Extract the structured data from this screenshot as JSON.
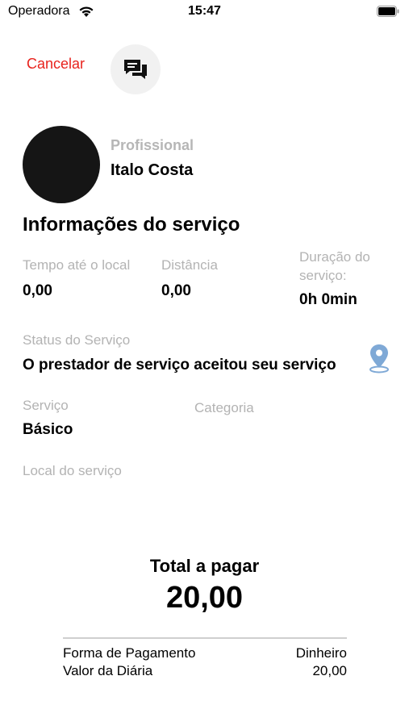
{
  "status_bar": {
    "carrier": "Operadora",
    "time": "15:47"
  },
  "header": {
    "cancel_label": "Cancelar",
    "chat_icon": "chat-bubbles-icon"
  },
  "professional": {
    "label": "Profissional",
    "name": "Italo Costa"
  },
  "service_info": {
    "title": "Informações do serviço",
    "travel_time": {
      "label": "Tempo até o local",
      "value": "0,00"
    },
    "distance": {
      "label": "Distância",
      "value": "0,00"
    },
    "duration": {
      "label_line1": "Duração do",
      "label_line2": "serviço:",
      "value": "0h 0min"
    },
    "status": {
      "label": "Status do Serviço",
      "value": "O prestador de serviço aceitou seu serviço",
      "icon": "location-pin-icon"
    },
    "service": {
      "label": "Serviço",
      "value": "Básico"
    },
    "category": {
      "label": "Categoria",
      "value": ""
    },
    "location": {
      "label": "Local do serviço",
      "value": ""
    }
  },
  "total": {
    "label": "Total a pagar",
    "value": "20,00"
  },
  "payment": {
    "method_label": "Forma de Pagamento",
    "method_value": "Dinheiro",
    "daily_label": "Valor da Diária",
    "daily_value": "20,00"
  },
  "colors": {
    "accent_red": "#e8231d",
    "label_gray": "#b3b3b3",
    "pin_blue": "#7fa9d6"
  }
}
